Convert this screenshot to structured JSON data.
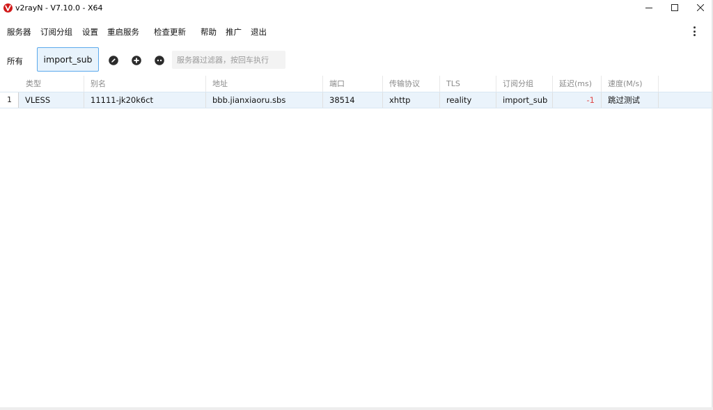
{
  "window": {
    "title": "v2rayN - V7.10.0 - X64",
    "brand_color": "#d11a1a"
  },
  "menu": {
    "items": [
      "服务器",
      "订阅分组",
      "设置",
      "重启服务",
      "检查更新",
      "帮助",
      "推广",
      "退出"
    ]
  },
  "toolbar": {
    "tab_all": "所有",
    "tab_active": "import_sub",
    "filter_placeholder": "服务器过滤器，按回车执行",
    "filter_value": ""
  },
  "table": {
    "columns": [
      "类型",
      "别名",
      "地址",
      "端口",
      "传输协议",
      "TLS",
      "订阅分组",
      "延迟(ms)",
      "速度(M/s)"
    ],
    "rows": [
      {
        "index": "1",
        "type": "VLESS",
        "alias": "11111-jk20k6ct",
        "address": "bbb.jianxiaoru.sbs",
        "port": "38514",
        "transport": "xhttp",
        "tls": "reality",
        "subgroup": "import_sub",
        "delay": "-1",
        "speed": "跳过测试"
      }
    ]
  },
  "colors": {
    "accent": "#5aa9ec",
    "selected_row": "#eaf3fb",
    "negative": "#e04848"
  }
}
